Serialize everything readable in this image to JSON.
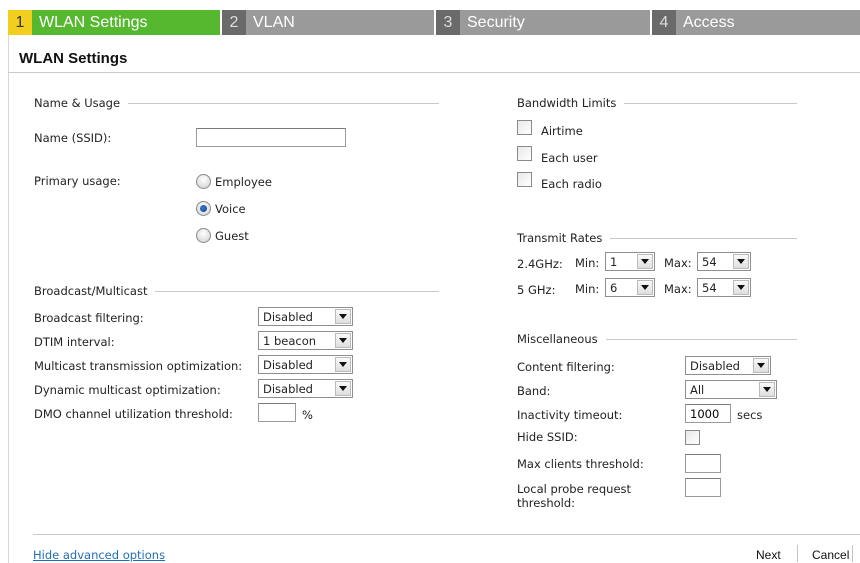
{
  "wizard": {
    "steps": [
      {
        "num": "1",
        "label": "WLAN Settings",
        "active": true
      },
      {
        "num": "2",
        "label": "VLAN"
      },
      {
        "num": "3",
        "label": "Security"
      },
      {
        "num": "4",
        "label": "Access"
      }
    ],
    "active_color": "#55b82e",
    "active_num_color": "#f2cf1f",
    "inactive_color": "#9a9a9a"
  },
  "title": "WLAN Settings",
  "name_usage": {
    "section_label": "Name & Usage",
    "ssid_label": "Name (SSID):",
    "ssid_value": "",
    "primary_usage_label": "Primary usage:",
    "options": [
      "Employee",
      "Voice",
      "Guest"
    ],
    "selected": "Voice"
  },
  "broadcast": {
    "section_label": "Broadcast/Multicast",
    "broadcast_filtering": {
      "label": "Broadcast filtering:",
      "value": "Disabled"
    },
    "dtim_interval": {
      "label": "DTIM interval:",
      "value": "1 beacon"
    },
    "multicast_tx_opt": {
      "label": "Multicast transmission optimization:",
      "value": "Disabled"
    },
    "dynamic_multicast_opt": {
      "label": "Dynamic multicast optimization:",
      "value": "Disabled"
    },
    "dmo_threshold": {
      "label": "DMO channel utilization threshold:",
      "value": "",
      "unit": "%"
    }
  },
  "bandwidth": {
    "section_label": "Bandwidth Limits",
    "airtime": "Airtime",
    "each_user": "Each user",
    "each_radio": "Each radio"
  },
  "transmit": {
    "section_label": "Transmit Rates",
    "band_24": "2.4GHz:",
    "band_5": "5 GHz:",
    "min_label": "Min:",
    "max_label": "Max:",
    "min_24": "1",
    "max_24": "54",
    "min_5": "6",
    "max_5": "54"
  },
  "misc": {
    "section_label": "Miscellaneous",
    "content_filtering": {
      "label": "Content filtering:",
      "value": "Disabled"
    },
    "band": {
      "label": "Band:",
      "value": "All"
    },
    "inactivity_timeout": {
      "label": "Inactivity timeout:",
      "value": "1000",
      "unit": "secs"
    },
    "hide_ssid": {
      "label": "Hide SSID:",
      "checked": false
    },
    "max_clients": {
      "label": "Max clients threshold:",
      "value": ""
    },
    "local_probe": {
      "label_line1": "Local probe request",
      "label_line2": "threshold:",
      "value": ""
    }
  },
  "footer": {
    "hide_advanced": "Hide advanced options",
    "next": "Next",
    "cancel": "Cancel",
    "link_color": "#1f6fb5"
  }
}
